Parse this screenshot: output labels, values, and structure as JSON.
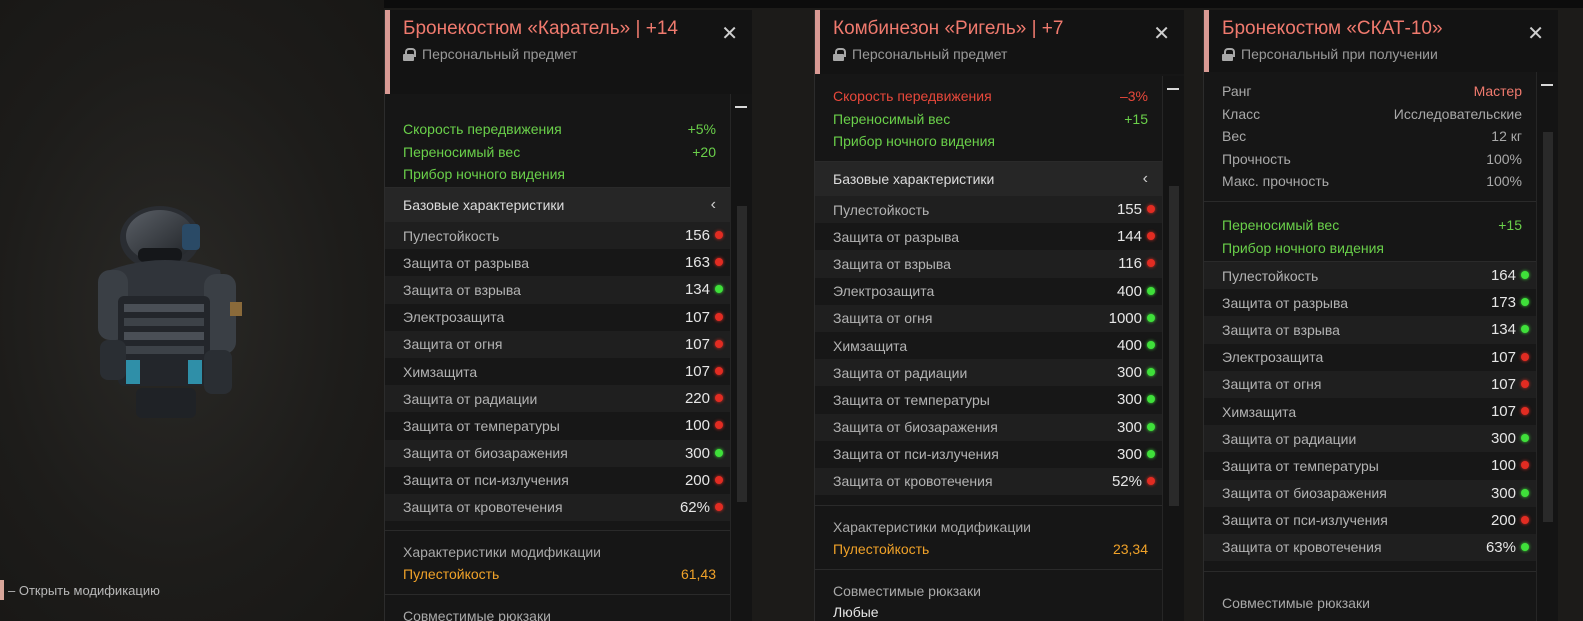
{
  "hint": {
    "text": "– Открыть модификацию"
  },
  "panels": [
    {
      "title": "Бронекостюм «Каратель» | +14",
      "subtitle": "Персональный предмет",
      "bonuses": [
        {
          "name": "Скорость передвижения",
          "value": "+5%",
          "tone": "green"
        },
        {
          "name": "Переносимый вес",
          "value": "+20",
          "tone": "green"
        },
        {
          "name": "Прибор ночного видения",
          "value": "",
          "tone": "green"
        }
      ],
      "section_title": "Базовые характеристики",
      "stats": [
        {
          "name": "Пулестойкость",
          "value": "156",
          "trend": "bad"
        },
        {
          "name": "Защита от разрыва",
          "value": "163",
          "trend": "bad"
        },
        {
          "name": "Защита от взрыва",
          "value": "134",
          "trend": "good"
        },
        {
          "name": "Электрозащита",
          "value": "107",
          "trend": "bad"
        },
        {
          "name": "Защита от огня",
          "value": "107",
          "trend": "bad"
        },
        {
          "name": "Химзащита",
          "value": "107",
          "trend": "bad"
        },
        {
          "name": "Защита от радиации",
          "value": "220",
          "trend": "bad"
        },
        {
          "name": "Защита от температуры",
          "value": "100",
          "trend": "bad"
        },
        {
          "name": "Защита от биозаражения",
          "value": "300",
          "trend": "good"
        },
        {
          "name": "Защита от пси-излучения",
          "value": "200",
          "trend": "bad"
        },
        {
          "name": "Защита от кровотечения",
          "value": "62%",
          "trend": "bad"
        }
      ],
      "mod_title": "Характеристики модификации",
      "mod_name": "Пулестойкость",
      "mod_value": "61,43",
      "backpacks_title": "Совместимые рюкзаки",
      "backpacks_value": ""
    },
    {
      "title": "Комбинезон «Ригель» | +7",
      "subtitle": "Персональный предмет",
      "bonuses": [
        {
          "name": "Скорость передвижения",
          "value": "–3%",
          "tone": "red"
        },
        {
          "name": "Переносимый вес",
          "value": "+15",
          "tone": "green"
        },
        {
          "name": "Прибор ночного видения",
          "value": "",
          "tone": "green"
        }
      ],
      "section_title": "Базовые характеристики",
      "stats": [
        {
          "name": "Пулестойкость",
          "value": "155",
          "trend": "bad"
        },
        {
          "name": "Защита от разрыва",
          "value": "144",
          "trend": "bad"
        },
        {
          "name": "Защита от взрыва",
          "value": "116",
          "trend": "bad"
        },
        {
          "name": "Электрозащита",
          "value": "400",
          "trend": "good"
        },
        {
          "name": "Защита от огня",
          "value": "1000",
          "trend": "good"
        },
        {
          "name": "Химзащита",
          "value": "400",
          "trend": "good"
        },
        {
          "name": "Защита от радиации",
          "value": "300",
          "trend": "good"
        },
        {
          "name": "Защита от температуры",
          "value": "300",
          "trend": "good"
        },
        {
          "name": "Защита от биозаражения",
          "value": "300",
          "trend": "good"
        },
        {
          "name": "Защита от пси-излучения",
          "value": "300",
          "trend": "good"
        },
        {
          "name": "Защита от кровотечения",
          "value": "52%",
          "trend": "bad"
        }
      ],
      "mod_title": "Характеристики модификации",
      "mod_name": "Пулестойкость",
      "mod_value": "23,34",
      "backpacks_title": "Совместимые рюкзаки",
      "backpacks_value": "Любые"
    },
    {
      "title": "Бронекостюм «СКАТ-10»",
      "subtitle": "Персональный при получении",
      "info": [
        {
          "name": "Ранг",
          "value": "Мастер",
          "tone": "rank"
        },
        {
          "name": "Класс",
          "value": "Исследовательские",
          "tone": "gray"
        },
        {
          "name": "Вес",
          "value": "12 кг",
          "tone": "gray"
        },
        {
          "name": "Прочность",
          "value": "100%",
          "tone": "gray"
        },
        {
          "name": "Макс. прочность",
          "value": "100%",
          "tone": "gray"
        }
      ],
      "bonuses": [
        {
          "name": "Переносимый вес",
          "value": "+15",
          "tone": "green"
        },
        {
          "name": "Прибор ночного видения",
          "value": "",
          "tone": "green"
        }
      ],
      "stats": [
        {
          "name": "Пулестойкость",
          "value": "164",
          "trend": "good"
        },
        {
          "name": "Защита от разрыва",
          "value": "173",
          "trend": "good"
        },
        {
          "name": "Защита от взрыва",
          "value": "134",
          "trend": "good"
        },
        {
          "name": "Электрозащита",
          "value": "107",
          "trend": "bad"
        },
        {
          "name": "Защита от огня",
          "value": "107",
          "trend": "bad"
        },
        {
          "name": "Химзащита",
          "value": "107",
          "trend": "bad"
        },
        {
          "name": "Защита от радиации",
          "value": "300",
          "trend": "good"
        },
        {
          "name": "Защита от температуры",
          "value": "100",
          "trend": "bad"
        },
        {
          "name": "Защита от биозаражения",
          "value": "300",
          "trend": "good"
        },
        {
          "name": "Защита от пси-излучения",
          "value": "200",
          "trend": "bad"
        },
        {
          "name": "Защита от кровотечения",
          "value": "63%",
          "trend": "good"
        }
      ],
      "backpacks_title": "Совместимые рюкзаки",
      "backpacks_value": ""
    }
  ]
}
